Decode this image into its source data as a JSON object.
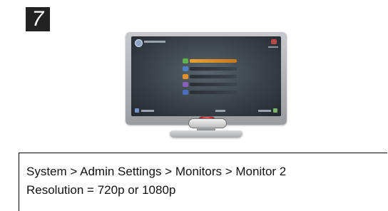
{
  "step": {
    "number": "7"
  },
  "instructions": {
    "path": "System > Admin Settings > Monitors > Monitor 2",
    "setting": "Resolution = 720p or 1080p"
  },
  "monitor_menu": {
    "selected_index": 0,
    "items": [
      {
        "icon": "green-icon",
        "color": "#5fb04a"
      },
      {
        "icon": "blue-icon",
        "color": "#4f7fc4"
      },
      {
        "icon": "orange-icon",
        "color": "#e0922a"
      },
      {
        "icon": "purple-icon",
        "color": "#8a5fb8"
      },
      {
        "icon": "blue-icon",
        "color": "#4a70b8"
      }
    ]
  },
  "colors": {
    "selected_bar": "#e8a230",
    "bezel_button": "#d62f2f"
  }
}
